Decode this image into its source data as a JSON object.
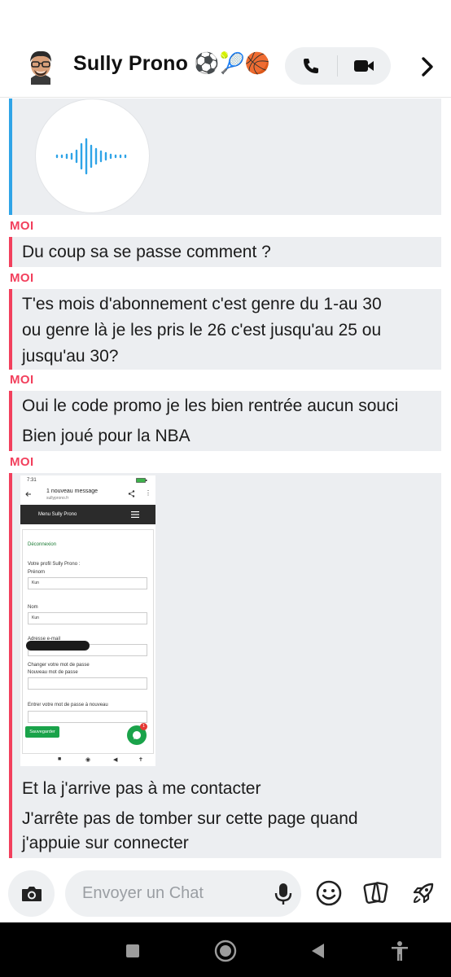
{
  "header": {
    "contact_name": "Sully Prono ⚽🎾🏀",
    "avatar": "bitmoji-avatar",
    "call_icon": "phone-icon",
    "video_icon": "video-camera-icon",
    "more_icon": "chevron-right-icon"
  },
  "messages": {
    "sender_label": "MOI",
    "m1": "Du coup sa se passe comment ?",
    "m2_line1": "T'es mois d'abonnement c'est genre du 1-au 30",
    "m2_line2": "ou genre là je les pris le 26 c'est jusqu'au 25 ou",
    "m2_line3": "jusqu'au 30?",
    "m3a": "Oui le code promo je les bien rentrée aucun souci",
    "m3b": "Bien joué pour la NBA",
    "m4a": "Et la j'arrive pas à me contacter",
    "m4b_line1": "J'arrête pas de tomber sur cette page quand",
    "m4b_line2": "j'appuie sur connecter"
  },
  "screenshot": {
    "time": "7:31",
    "notif_title": "1 nouveau message",
    "notif_url": "sullyprono.fr",
    "menu": "Menu Sully Prono",
    "logout": "Déconnexion",
    "profile_heading": "Votre profil Sully Prono :",
    "prenom_label": "Prénom",
    "prenom_value": "Kun",
    "nom_label": "Nom",
    "nom_value": "Kun",
    "email_label": "Adresse e-mail",
    "change_pw": "Changer votre mot de passe",
    "new_pw": "Nouveau mot de passe",
    "repeat_pw": "Entrer votre mot de passe à nouveau",
    "save": "Sauvegarder",
    "badge": "1"
  },
  "input": {
    "placeholder": "Envoyer un Chat"
  },
  "colors": {
    "accent_red": "#f2405d",
    "accent_blue": "#2fa4e7",
    "bubble_bg": "#eceef1"
  }
}
